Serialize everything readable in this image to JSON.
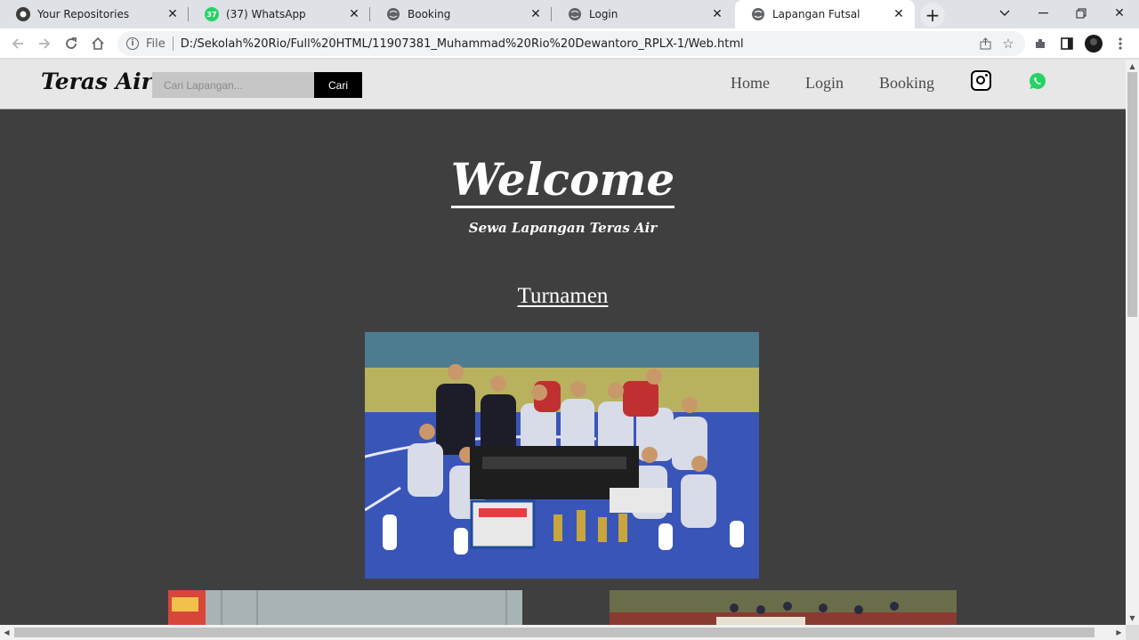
{
  "browser": {
    "tabs": [
      {
        "title": "Your Repositories",
        "icon": "github-icon",
        "active": false
      },
      {
        "title": "(37) WhatsApp",
        "icon": "whatsapp-icon",
        "badge": "37",
        "active": false
      },
      {
        "title": "Booking",
        "icon": "globe-icon",
        "active": false
      },
      {
        "title": "Login",
        "icon": "globe-icon",
        "active": false
      },
      {
        "title": "Lapangan Futsal",
        "icon": "globe-icon",
        "active": true
      }
    ],
    "scheme_label": "File",
    "url": "D:/Sekolah%20Rio/Full%20HTML/11907381_Muhammad%20Rio%20Dewantoro_RPLX-1/Web.html"
  },
  "page": {
    "brand": "Teras Air",
    "search": {
      "placeholder": "Cari Lapangan...",
      "value": "",
      "button_label": "Cari"
    },
    "nav": {
      "home": "Home",
      "login": "Login",
      "booking": "Booking"
    },
    "hero": {
      "title": "Welcome",
      "subtitle": "Sewa Lapangan Teras Air"
    },
    "section_title": "Turnamen",
    "colors": {
      "page_bg": "#3f3f3f",
      "navbar_bg": "#e7e7e7",
      "whatsapp_green": "#25d366"
    }
  }
}
